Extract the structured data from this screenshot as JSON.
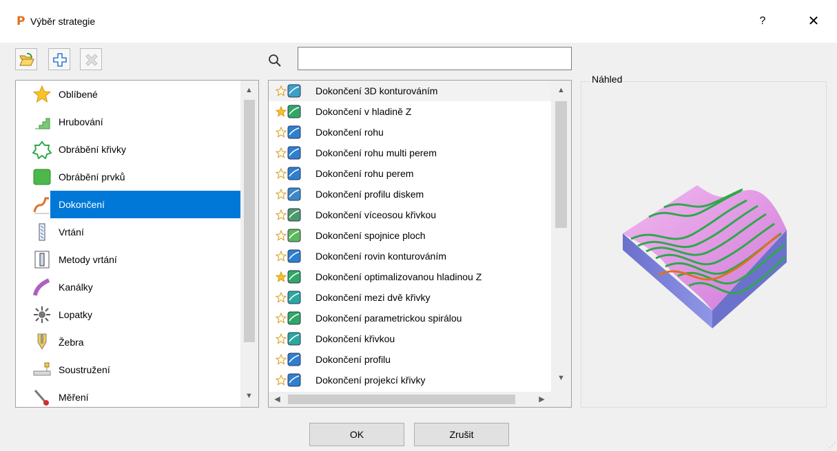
{
  "window": {
    "title": "Výběr strategie",
    "help_label": "?",
    "close_label": "✕"
  },
  "toolbar": {
    "buttons": [
      {
        "name": "open-folder-icon"
      },
      {
        "name": "add-icon"
      },
      {
        "name": "delete-icon"
      }
    ]
  },
  "categories": [
    {
      "label": "Oblíbené",
      "icon": "star-icon"
    },
    {
      "label": "Hrubování",
      "icon": "roughing-icon"
    },
    {
      "label": "Obrábění křivky",
      "icon": "curve-icon"
    },
    {
      "label": "Obrábění prvků",
      "icon": "feature-icon"
    },
    {
      "label": "Dokončení",
      "icon": "finishing-icon",
      "selected": true
    },
    {
      "label": "Vrtání",
      "icon": "drill-icon"
    },
    {
      "label": "Metody vrtání",
      "icon": "drill-methods-icon"
    },
    {
      "label": "Kanálky",
      "icon": "port-icon"
    },
    {
      "label": "Lopatky",
      "icon": "blade-icon"
    },
    {
      "label": "Žebra",
      "icon": "rib-icon"
    },
    {
      "label": "Soustružení",
      "icon": "turning-icon"
    },
    {
      "label": "Měření",
      "icon": "probe-icon"
    }
  ],
  "search": {
    "value": "",
    "placeholder": ""
  },
  "strategies": [
    {
      "label": "Dokončení 3D konturováním",
      "favorite": false,
      "color": "#3aa0c8"
    },
    {
      "label": "Dokončení v hladině Z",
      "favorite": true,
      "color": "#2fa866"
    },
    {
      "label": "Dokončení rohu",
      "favorite": false,
      "color": "#2d7fd0"
    },
    {
      "label": "Dokončení rohu multi perem",
      "favorite": false,
      "color": "#2d7fd0"
    },
    {
      "label": "Dokončení rohu perem",
      "favorite": false,
      "color": "#2d7fd0"
    },
    {
      "label": "Dokončení profilu diskem",
      "favorite": false,
      "color": "#3a88c8"
    },
    {
      "label": "Dokončení víceosou křivkou",
      "favorite": false,
      "color": "#4a9a6a"
    },
    {
      "label": "Dokončení spojnice ploch",
      "favorite": false,
      "color": "#5cb85c"
    },
    {
      "label": "Dokončení rovin konturováním",
      "favorite": false,
      "color": "#2d7fd0"
    },
    {
      "label": "Dokončení optimalizovanou hladinou Z",
      "favorite": true,
      "color": "#2fa866"
    },
    {
      "label": "Dokončení mezi dvě křivky",
      "favorite": false,
      "color": "#2aa8a0"
    },
    {
      "label": "Dokončení parametrickou spirálou",
      "favorite": false,
      "color": "#2fa866"
    },
    {
      "label": "Dokončení křivkou",
      "favorite": false,
      "color": "#2aa8a0"
    },
    {
      "label": "Dokončení profilu",
      "favorite": false,
      "color": "#2d7fd0"
    },
    {
      "label": "Dokončení projekcí křivky",
      "favorite": false,
      "color": "#2d7fd0"
    }
  ],
  "preview": {
    "label": "Náhled"
  },
  "buttons": {
    "ok": "OK",
    "cancel": "Zrušit"
  },
  "colors": {
    "selection": "#0078d7",
    "preview_top": "#e6a0e8",
    "preview_side": "#7c82d8",
    "stripe_green": "#2ea84a",
    "stripe_orange": "#e07020"
  }
}
